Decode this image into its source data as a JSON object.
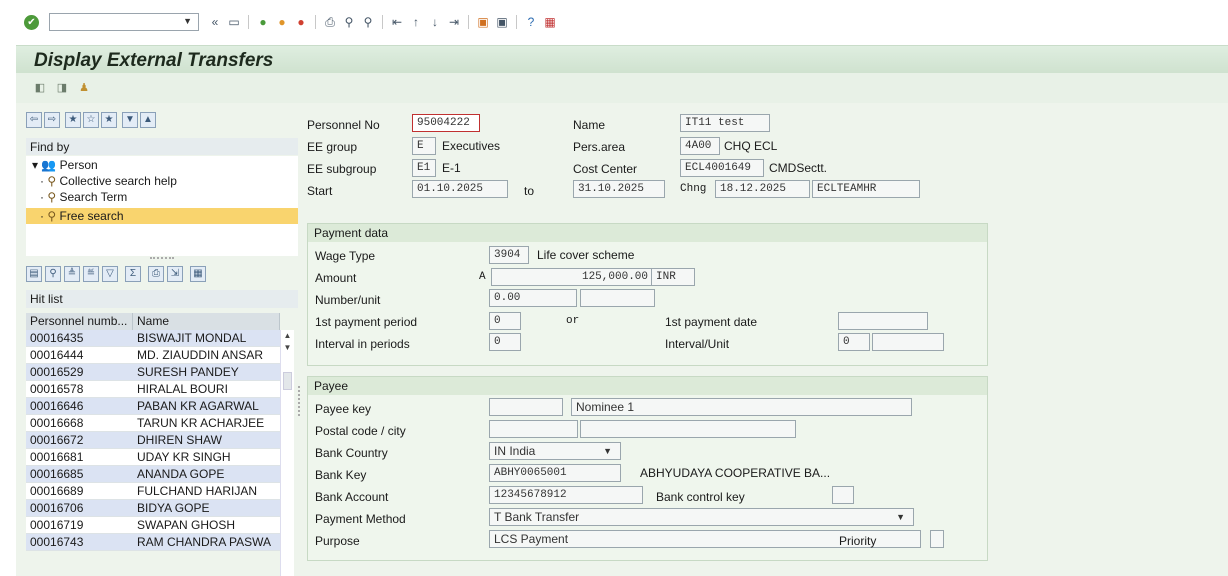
{
  "toolbar": {
    "icons": [
      "enter-icon",
      "back-icon",
      "save-icon",
      "back-nav-icon",
      "exit-icon",
      "cancel-icon",
      "print-icon",
      "find-icon",
      "find-next-icon",
      "first-page-icon",
      "prev-page-icon",
      "next-page-icon",
      "last-page-icon",
      "new-session-icon",
      "shortcut-icon",
      "help-icon",
      "customize-icon"
    ]
  },
  "screen": {
    "title": "Display External Transfers"
  },
  "header": {
    "personnel_no_label": "Personnel No",
    "personnel_no": "95004222",
    "name_label": "Name",
    "name": "IT11 test",
    "ee_group_label": "EE group",
    "ee_group_code": "E",
    "ee_group_text": "Executives",
    "pers_area_label": "Pers.area",
    "pers_area_code": "4A00",
    "pers_area_text": "CHQ ECL",
    "ee_subgroup_label": "EE subgroup",
    "ee_subgroup_code": "E1",
    "ee_subgroup_text": "E-1",
    "cost_center_label": "Cost Center",
    "cost_center_code": "ECL4001649",
    "cost_center_text": "CMDSectt.",
    "start_label": "Start",
    "start": "01.10.2025",
    "to_label": "to",
    "end": "31.10.2025",
    "chng_label": "Chng",
    "chng_date": "18.12.2025",
    "chng_user": "ECLTEAMHR"
  },
  "payment": {
    "title": "Payment data",
    "wage_type_label": "Wage Type",
    "wage_type": "3904",
    "wage_type_text": "Life cover scheme",
    "amount_label": "Amount",
    "amount_prefix": "A",
    "amount": "125,000.00",
    "currency": "INR",
    "number_label": "Number/unit",
    "number": "0.00",
    "unit": "",
    "first_period_label": "1st payment period",
    "first_period": "0",
    "or_label": "or",
    "first_date_label": "1st payment date",
    "first_date": "",
    "interval_label": "Interval in periods",
    "interval": "0",
    "interval_unit_label": "Interval/Unit",
    "interval_unit": "0",
    "interval_unit2": ""
  },
  "payee": {
    "title": "Payee",
    "payee_key_label": "Payee key",
    "payee_key": "",
    "payee_name": "Nominee 1",
    "postal_label": "Postal code / city",
    "postal": "",
    "city": "",
    "bank_country_label": "Bank Country",
    "bank_country": "IN India",
    "bank_key_label": "Bank Key",
    "bank_key": "ABHY0065001",
    "bank_name": "ABHYUDAYA COOPERATIVE BA...",
    "bank_account_label": "Bank Account",
    "bank_account": "12345678912",
    "bank_control_label": "Bank control key",
    "bank_control": "",
    "payment_method_label": "Payment Method",
    "payment_method": "T Bank Transfer",
    "purpose_label": "Purpose",
    "purpose": "LCS Payment",
    "priority_label": "Priority",
    "priority": ""
  },
  "finder": {
    "find_by": "Find by",
    "tree": [
      "Person",
      "Collective search help",
      "Search Term",
      "Free search"
    ],
    "hit_list": "Hit list",
    "columns": [
      "Personnel numb...",
      "Name"
    ],
    "rows": [
      [
        "00016435",
        "BISWAJIT MONDAL"
      ],
      [
        "00016444",
        "MD.  ZIAUDDIN ANSAR"
      ],
      [
        "00016529",
        "SURESH PANDEY"
      ],
      [
        "00016578",
        "HIRALAL BOURI"
      ],
      [
        "00016646",
        "PABAN KR AGARWAL"
      ],
      [
        "00016668",
        "TARUN KR ACHARJEE"
      ],
      [
        "00016672",
        "DHIREN SHAW"
      ],
      [
        "00016681",
        "UDAY KR SINGH"
      ],
      [
        "00016685",
        "ANANDA GOPE"
      ],
      [
        "00016689",
        "FULCHAND HARIJAN"
      ],
      [
        "00016706",
        "BIDYA GOPE"
      ],
      [
        "00016719",
        "SWAPAN GHOSH"
      ],
      [
        "00016743",
        "RAM CHANDRA PASWA"
      ]
    ]
  }
}
